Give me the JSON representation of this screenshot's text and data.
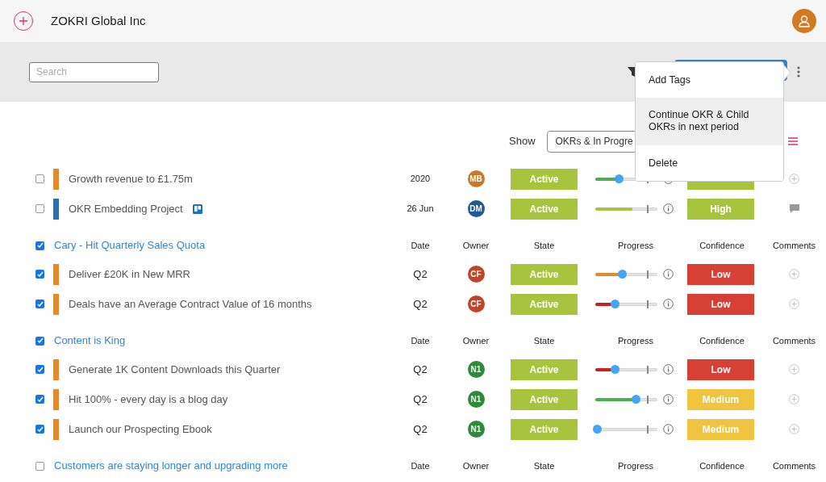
{
  "header": {
    "company": "ZOKRI Global Inc"
  },
  "toolbar": {
    "search": {
      "placeholder": "Search"
    }
  },
  "show": {
    "label": "Show",
    "value": "OKRs & In Progre"
  },
  "menu": {
    "items": [
      {
        "label": "Add Tags",
        "selected": false
      },
      {
        "label": "Continue OKR & Child OKRs in next period",
        "selected": true
      },
      {
        "label": "Delete",
        "selected": false
      }
    ]
  },
  "groups": [
    {
      "items": [
        {
          "checked": false,
          "bar": {
            "color": "#e08b2e"
          },
          "title": "Growth revenue to £1.75m",
          "linked_board": false,
          "date": "2020",
          "owner": {
            "initials": "MB",
            "color": "#c9782a"
          },
          "state": "Active",
          "progress": {
            "level": 0.35,
            "color": "#4caf50",
            "thumb": true
          },
          "confidence": {
            "color": "#a8c33d"
          },
          "comment": {
            "kind": "add"
          }
        },
        {
          "checked": false,
          "bar": {
            "color": "#2f6ea8"
          },
          "title": "OKR Embedding Project",
          "linked_board": true,
          "date": "26 Jun",
          "owner": {
            "initials": "DM",
            "color": "#1f5a96"
          },
          "state": "Active",
          "progress": {
            "level": 0.6,
            "color": "#a8c33d",
            "thumb": false
          },
          "confidence": {
            "label": "High",
            "color": "#a8c33d"
          },
          "comment": {
            "kind": "comment"
          }
        }
      ]
    },
    {
      "title": "Cary - Hit Quarterly Sales Quota",
      "checked": true,
      "columns": [
        "Date",
        "Owner",
        "State",
        "Progress",
        "Confidence",
        "Comments"
      ],
      "items": [
        {
          "checked": true,
          "bar": {
            "color": "#e08b2e"
          },
          "title": "Deliver £20K in New MRR",
          "linked_board": false,
          "date": "Q2",
          "owner": {
            "initials": "CF",
            "color": "#c0442a"
          },
          "state": "Active",
          "progress": {
            "level": 0.4,
            "color": "#e08b2e",
            "thumb": true
          },
          "confidence": {
            "label": "Low",
            "color": "#d64035"
          },
          "comment": {
            "kind": "add"
          }
        },
        {
          "checked": true,
          "bar": {
            "color": "#e08b2e"
          },
          "title": "Deals have an Average Contract Value of 16 months",
          "linked_board": false,
          "date": "Q2",
          "owner": {
            "initials": "CF",
            "color": "#c0442a"
          },
          "state": "Active",
          "progress": {
            "level": 0.28,
            "color": "#c62020",
            "thumb": true
          },
          "confidence": {
            "label": "Low",
            "color": "#d64035"
          },
          "comment": {
            "kind": "add"
          }
        }
      ]
    },
    {
      "title": "Content is King",
      "checked": true,
      "columns": [
        "Date",
        "Owner",
        "State",
        "Progress",
        "Confidence",
        "Comments"
      ],
      "items": [
        {
          "checked": true,
          "bar": {
            "color": "#e08b2e"
          },
          "title": "Generate 1K Content Downloads this Quarter",
          "linked_board": false,
          "date": "Q2",
          "owner": {
            "initials": "N1",
            "color": "#2e8b3a"
          },
          "state": "Active",
          "progress": {
            "level": 0.28,
            "color": "#c62020",
            "thumb": true
          },
          "confidence": {
            "label": "Low",
            "color": "#d64035"
          },
          "comment": {
            "kind": "add"
          }
        },
        {
          "checked": true,
          "bar": {
            "color": "#e08b2e"
          },
          "title": "Hit 100% - every day is a blog day",
          "linked_board": false,
          "date": "Q2",
          "owner": {
            "initials": "N1",
            "color": "#2e8b3a"
          },
          "state": "Active",
          "progress": {
            "level": 0.62,
            "color": "#4caf50",
            "thumb": true
          },
          "confidence": {
            "label": "Medium",
            "color": "#f0c43f"
          },
          "comment": {
            "kind": "add"
          }
        },
        {
          "checked": true,
          "bar": {
            "color": "#e08b2e"
          },
          "title": "Launch our Prospecting Ebook",
          "linked_board": false,
          "date": "Q2",
          "owner": {
            "initials": "N1",
            "color": "#2e8b3a"
          },
          "state": "Active",
          "progress": {
            "level": 0,
            "thumb": true
          },
          "confidence": {
            "label": "Medium",
            "color": "#f0c43f"
          },
          "comment": {
            "kind": "add"
          }
        }
      ]
    },
    {
      "title": "Customers are staying longer and upgrading more",
      "checked": false,
      "columns": [
        "Date",
        "Owner",
        "State",
        "Progress",
        "Confidence",
        "Comments"
      ]
    }
  ]
}
